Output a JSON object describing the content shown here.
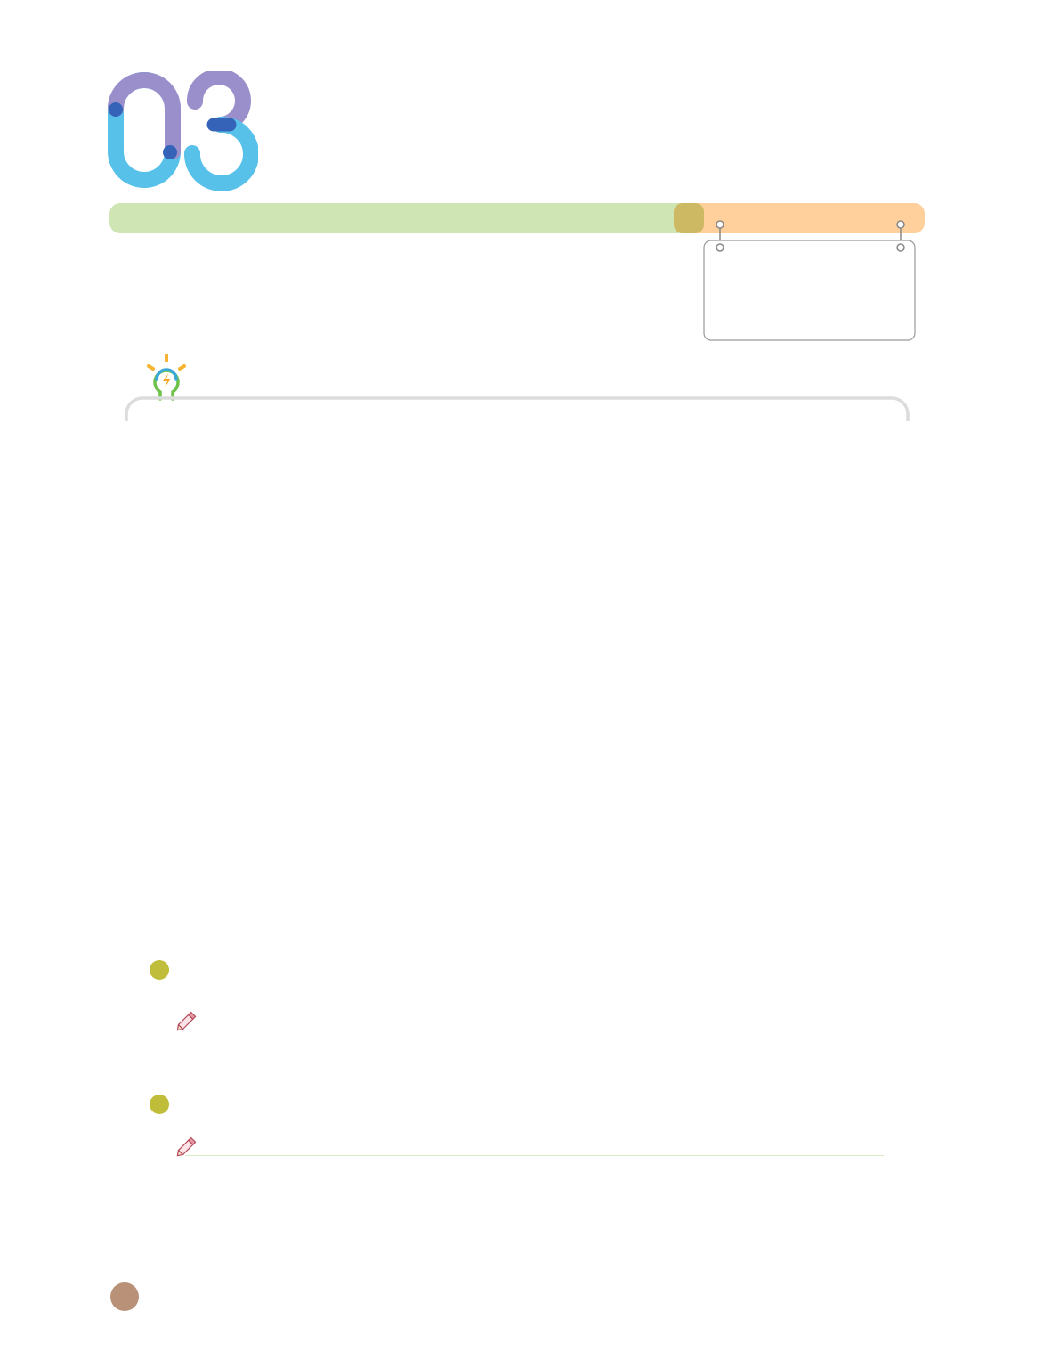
{
  "colors": {
    "digit_purple": "#9a8fcb",
    "digit_blue": "#57c1ea",
    "digit_dot": "#3563b8",
    "bar_green": "#cfe6b4",
    "bar_orange": "#ffd09b",
    "bar_knob": "#cdb963",
    "bullet": "#bfbd3a",
    "answer_line": "#d8ecc4",
    "page_circle": "#b89178",
    "frame_gray": "#d9d9d9"
  },
  "icons": {
    "idea": "lightbulb-icon",
    "pencil": "pencil-icon"
  },
  "questions": [
    {
      "bullet": "bullet-dot",
      "answer_prompt": "pencil-icon"
    },
    {
      "bullet": "bullet-dot",
      "answer_prompt": "pencil-icon"
    }
  ]
}
